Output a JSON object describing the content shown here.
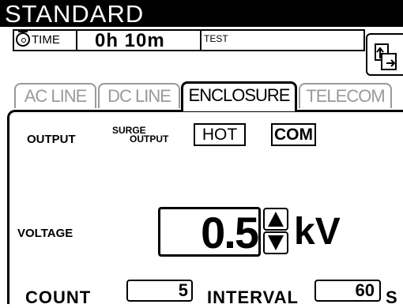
{
  "header": {
    "title": "STANDARD"
  },
  "status": {
    "time_label": "TIME",
    "time_value": "0h 10m",
    "test_label": "TEST",
    "clock_icon": "clock-icon",
    "page_icon": "page-switch-icon"
  },
  "tabs": [
    {
      "label": "AC LINE",
      "active": false
    },
    {
      "label": "DC LINE",
      "active": false
    },
    {
      "label": "ENCLOSURE",
      "active": true
    },
    {
      "label": "TELECOM",
      "active": false
    }
  ],
  "panel": {
    "output_label": "OUTPUT",
    "surge_output_line1": "SURGE",
    "surge_output_line2": "OUTPUT",
    "hot_label": "HOT",
    "com_label": "COM",
    "voltage_label": "VOLTAGE",
    "voltage_value": "0.5",
    "voltage_unit": "kV",
    "count_label": "COUNT",
    "count_value": "5",
    "interval_label": "INTERVAL",
    "interval_value": "60",
    "interval_unit": "S"
  },
  "colors": {
    "title_bg": "#000000",
    "title_fg": "#ffffff",
    "inactive_tab": "#9a9a9a"
  }
}
